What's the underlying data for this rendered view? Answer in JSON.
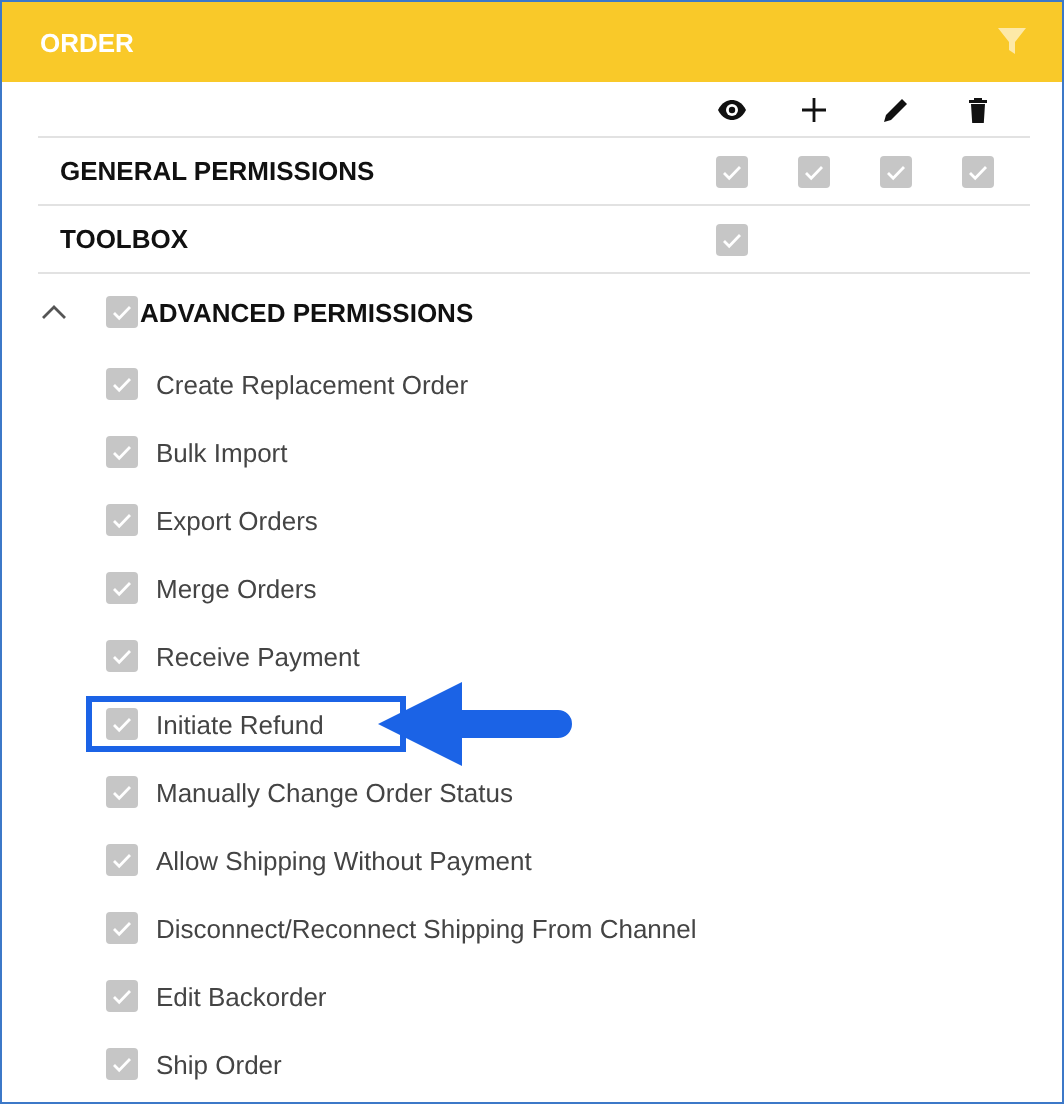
{
  "header": {
    "title": "ORDER"
  },
  "columns": [
    {
      "kind": "view"
    },
    {
      "kind": "add"
    },
    {
      "kind": "edit"
    },
    {
      "kind": "delete"
    }
  ],
  "sections": [
    {
      "label": "GENERAL PERMISSIONS",
      "checks": [
        {
          "checked": true
        },
        {
          "checked": true
        },
        {
          "checked": true
        },
        {
          "checked": true
        }
      ]
    },
    {
      "label": "TOOLBOX",
      "checks": [
        {
          "checked": true
        }
      ]
    }
  ],
  "advanced": {
    "label": "ADVANCED PERMISSIONS",
    "expanded": true,
    "checked": true,
    "items": [
      {
        "label": "Create Replacement Order",
        "checked": true,
        "highlighted": false
      },
      {
        "label": "Bulk Import",
        "checked": true,
        "highlighted": false
      },
      {
        "label": "Export Orders",
        "checked": true,
        "highlighted": false
      },
      {
        "label": "Merge Orders",
        "checked": true,
        "highlighted": false
      },
      {
        "label": "Receive Payment",
        "checked": true,
        "highlighted": false
      },
      {
        "label": "Initiate Refund",
        "checked": true,
        "highlighted": true
      },
      {
        "label": "Manually Change Order Status",
        "checked": true,
        "highlighted": false
      },
      {
        "label": "Allow Shipping Without Payment",
        "checked": true,
        "highlighted": false
      },
      {
        "label": "Disconnect/Reconnect Shipping From Channel",
        "checked": true,
        "highlighted": false
      },
      {
        "label": "Edit Backorder",
        "checked": true,
        "highlighted": false
      },
      {
        "label": "Ship Order",
        "checked": true,
        "highlighted": false
      }
    ]
  }
}
